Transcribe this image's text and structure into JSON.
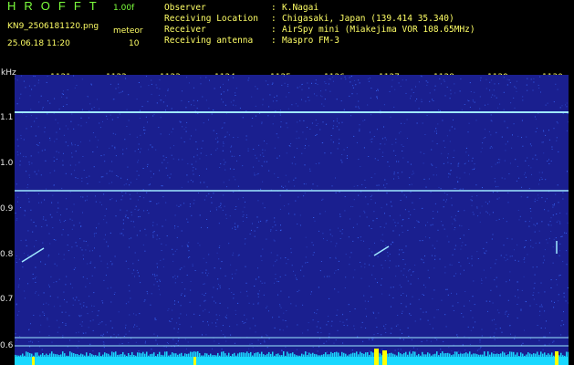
{
  "header": {
    "app_title": "HROFFT",
    "version": "1.00f",
    "filename": "KN9_2506181120.png",
    "datetime": "25.06.18 11:20",
    "mode_label": "meteor",
    "mode_value": "10",
    "info": [
      {
        "key": "Observer",
        "value": "K.Nagai"
      },
      {
        "key": "Receiving Location",
        "value": "Chigasaki, Japan (139.414 35.340)"
      },
      {
        "key": "Receiver",
        "value": "AirSpy mini (Miakejima VOR 108.65MHz)"
      },
      {
        "key": "Receiving antenna",
        "value": "Maspro FM-3"
      }
    ]
  },
  "plot": {
    "y_unit": "kHz",
    "y_ticks": [
      "1.1",
      "1.0",
      "0.9",
      "0.8",
      "0.7",
      "0.6"
    ],
    "x_ticks": [
      "1121",
      "1122",
      "1123",
      "1124",
      "1125",
      "1126",
      "1127",
      "1128",
      "1129",
      "1130"
    ],
    "colors": {
      "background": "#1a1f8f",
      "noise": "#3a6cff",
      "trace": "#9fe8ff",
      "baseline": "#19d8ff",
      "burst": "#ffff00"
    }
  }
}
